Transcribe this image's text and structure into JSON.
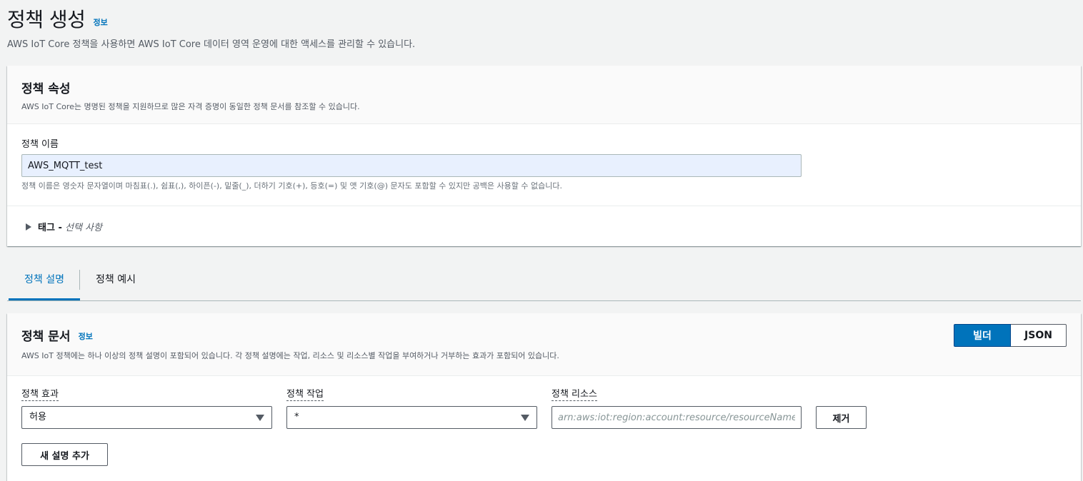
{
  "page": {
    "title": "정책 생성",
    "info": "정보",
    "description": "AWS IoT Core 정책을 사용하면 AWS IoT Core 데이터 영역 운영에 대한 액세스를 관리할 수 있습니다."
  },
  "properties": {
    "title": "정책 속성",
    "description": "AWS IoT Core는 명명된 정책을 지원하므로 많은 자격 증명이 동일한 정책 문서를 참조할 수 있습니다.",
    "name_label": "정책 이름",
    "name_value": "AWS_MQTT_test",
    "name_hint": "정책 이름은 영숫자 문자열이며 마침표(.), 쉼표(,), 하이픈(-), 밑줄(_), 더하기 기호(+), 등호(=) 및 앳 기호(@) 문자도 포함할 수 있지만 공백은 사용할 수 없습니다.",
    "tags_label": "태그 -",
    "tags_optional": "선택 사항"
  },
  "tabs": [
    {
      "label": "정책 설명"
    },
    {
      "label": "정책 예시"
    }
  ],
  "document": {
    "title": "정책 문서",
    "info": "정보",
    "description": "AWS IoT 정책에는 하나 이상의 정책 설명이 포함되어 있습니다. 각 정책 설명에는 작업, 리소스 및 리소스별 작업을 부여하거나 거부하는 효과가 포함되어 있습니다.",
    "mode_builder": "빌더",
    "mode_json": "JSON",
    "effect_label": "정책 효과",
    "effect_value": "허용",
    "action_label": "정책 작업",
    "action_value": "*",
    "resource_label": "정책 리소스",
    "resource_placeholder": "arn:aws:iot:region:account:resource/resourceName",
    "remove_label": "제거",
    "add_statement_label": "새 설명 추가"
  },
  "colors": {
    "accent": "#0073bb",
    "background": "#f2f3f3"
  }
}
